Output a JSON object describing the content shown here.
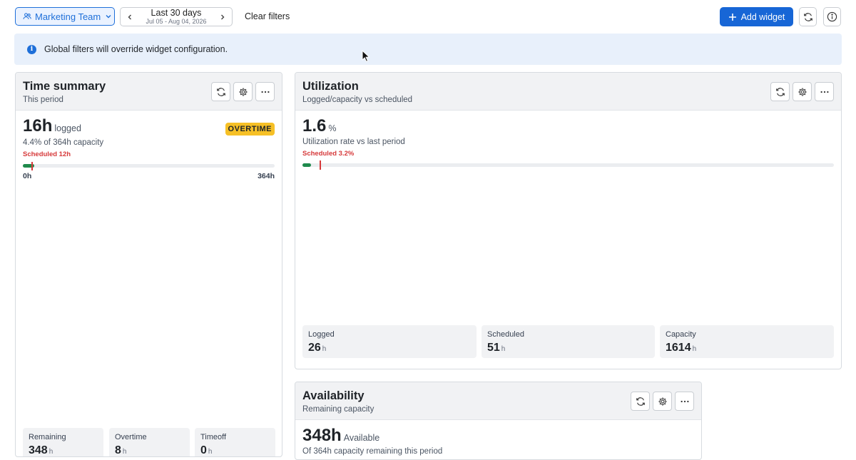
{
  "toolbar": {
    "team_label": "Marketing Team",
    "date_range_label": "Last 30 days",
    "date_range_sub": "Jul 05 - Aug 04, 2026",
    "clear_filters_label": "Clear filters",
    "add_widget_label": "Add widget"
  },
  "notice": {
    "text": "Global filters will override widget configuration."
  },
  "time_summary": {
    "title": "Time summary",
    "subtitle": "This period",
    "logged_value": "16h",
    "logged_unit": "logged",
    "capacity_text": "4.4% of 364h capacity",
    "badge": "OVERTIME",
    "scheduled_text": "Scheduled 12h",
    "logged_fraction": 0.044,
    "scheduled_fraction": 0.033,
    "axis_min": "0h",
    "axis_max": "364h",
    "stats": [
      {
        "label": "Remaining",
        "value": "348",
        "unit": "h"
      },
      {
        "label": "Overtime",
        "value": "8",
        "unit": "h"
      },
      {
        "label": "Timeoff",
        "value": "0",
        "unit": "h"
      }
    ]
  },
  "utilization": {
    "title": "Utilization",
    "subtitle": "Logged/capacity vs scheduled",
    "value": "1.6",
    "unit": "%",
    "desc": "Utilization rate vs last period",
    "scheduled_text": "Scheduled 3.2%",
    "logged_fraction": 0.016,
    "scheduled_fraction": 0.032,
    "stats": [
      {
        "label": "Logged",
        "value": "26",
        "unit": "h"
      },
      {
        "label": "Scheduled",
        "value": "51",
        "unit": "h"
      },
      {
        "label": "Capacity",
        "value": "1614",
        "unit": "h"
      }
    ]
  },
  "availability": {
    "title": "Availability",
    "subtitle": "Remaining capacity",
    "value": "348h",
    "unit": "Available",
    "desc": "Of 364h capacity remaining this period"
  },
  "colors": {
    "accent": "#1766d6",
    "progress": "#1f8a4c",
    "scheduled_marker": "#d6393a",
    "badge": "#f6c026"
  }
}
